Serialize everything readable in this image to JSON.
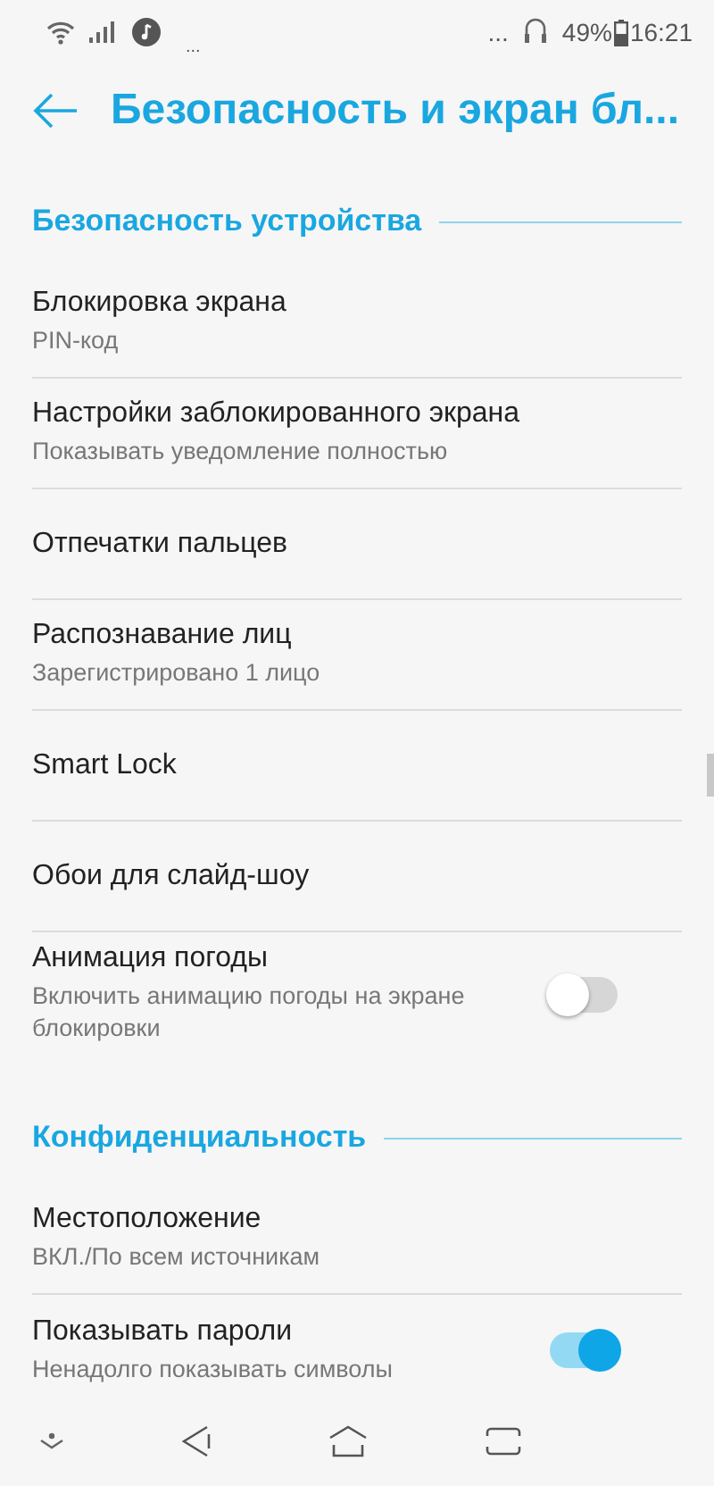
{
  "status_bar": {
    "dots_left": "...",
    "dots_right": "...",
    "battery": "49%",
    "time": "16:21"
  },
  "app_bar": {
    "title": "Безопасность и экран бл..."
  },
  "sections": [
    {
      "title": "Безопасность устройства",
      "items": [
        {
          "kind": "text",
          "title": "Блокировка экрана",
          "summary": "PIN-код"
        },
        {
          "kind": "text",
          "title": "Настройки заблокированного экрана",
          "summary": "Показывать уведомление полностью"
        },
        {
          "kind": "text",
          "title": "Отпечатки пальцев"
        },
        {
          "kind": "text",
          "title": "Распознавание лиц",
          "summary": "Зарегистрировано 1 лицо"
        },
        {
          "kind": "text",
          "title": "Smart Lock"
        },
        {
          "kind": "text",
          "title": "Обои для слайд-шоу"
        },
        {
          "kind": "switch",
          "title": "Анимация погоды",
          "summary": "Включить анимацию погоды на экране блокировки",
          "on": false
        }
      ]
    },
    {
      "title": "Конфиденциальность",
      "items": [
        {
          "kind": "text",
          "title": "Местоположение",
          "summary": "ВКЛ./По всем источникам"
        },
        {
          "kind": "switch",
          "title": "Показывать пароли",
          "summary": "Ненадолго показывать символы",
          "on": true
        }
      ]
    }
  ]
}
